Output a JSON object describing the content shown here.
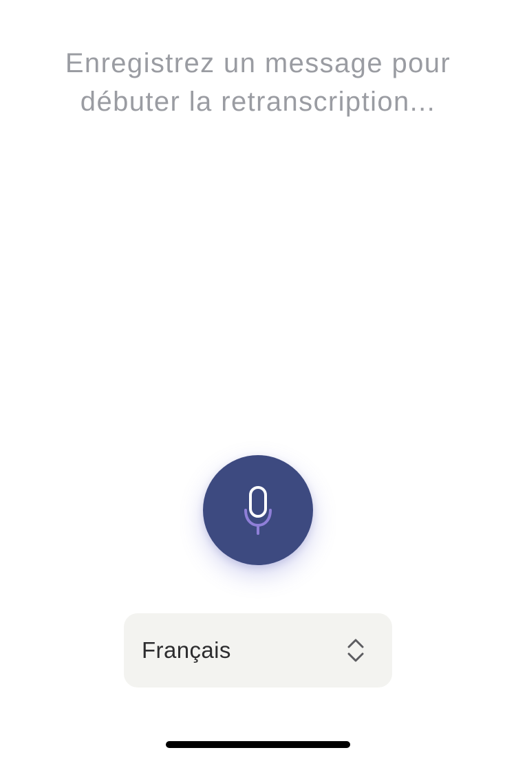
{
  "prompt": {
    "line1": "Enregistrez un message pour",
    "line2": "débuter la retranscription..."
  },
  "mic_button": {
    "icon": "microphone-icon",
    "background": "#3d4a80",
    "icon_color": "#ffffff",
    "accent_color": "#8f7fd8"
  },
  "language_select": {
    "selected": "Français",
    "icon": "chevron-up-down-icon"
  },
  "colors": {
    "prompt_text": "#9a9ca2",
    "select_background": "#f3f3f0",
    "home_indicator": "#000000"
  }
}
